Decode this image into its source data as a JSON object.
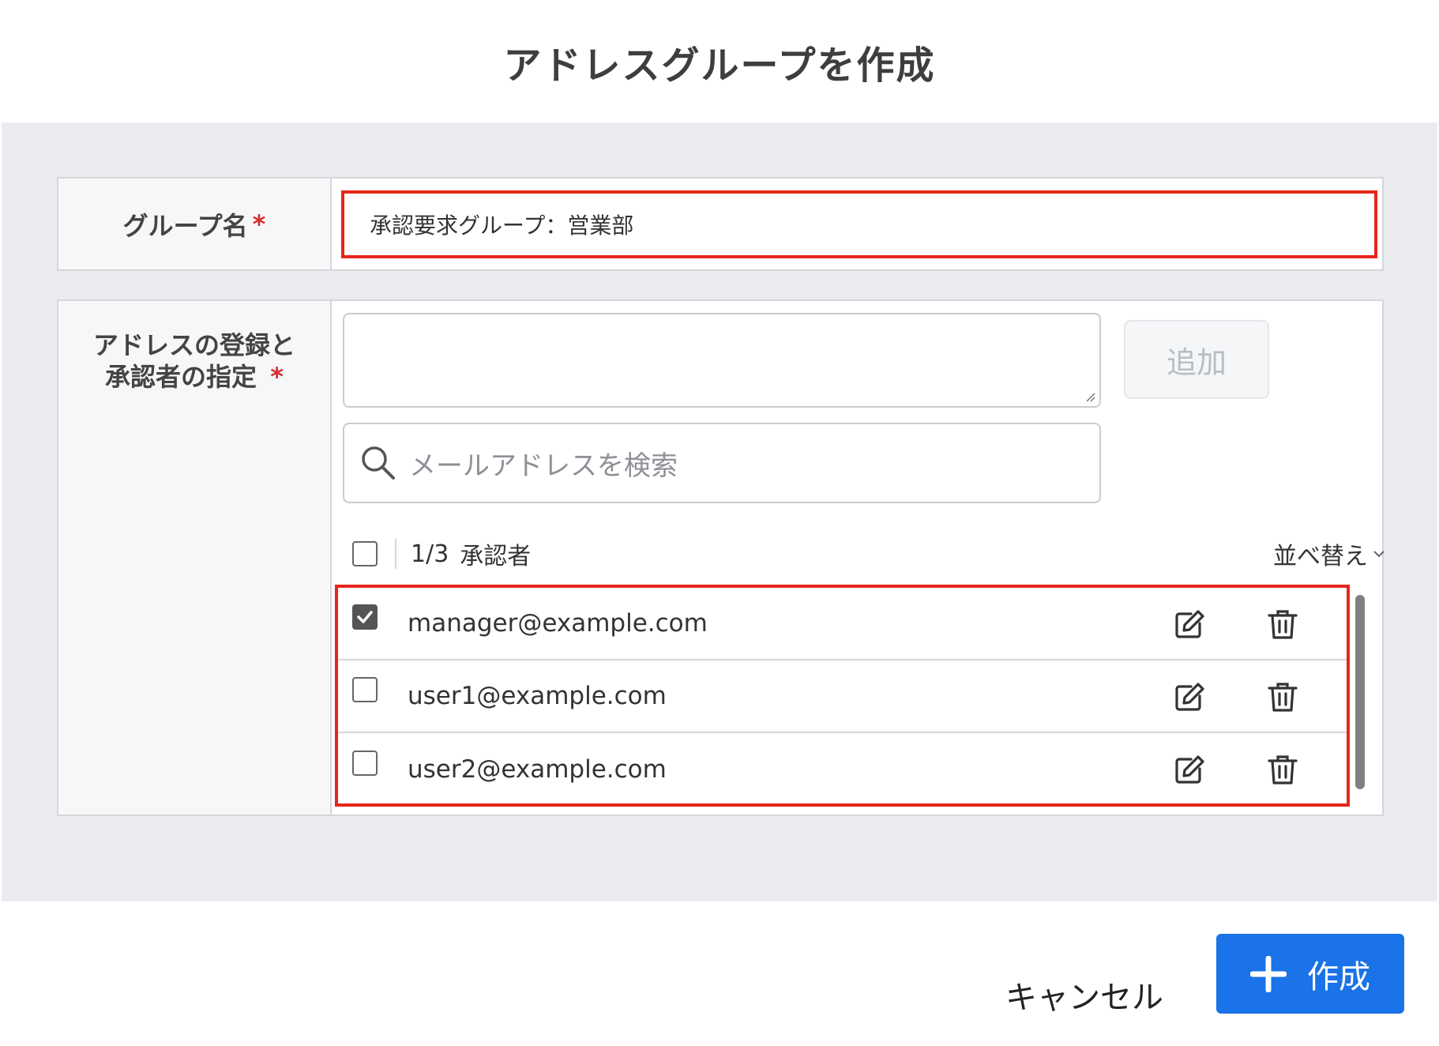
{
  "dialog": {
    "title": "アドレスグループを作成"
  },
  "form": {
    "group_name_label": "グループ名",
    "group_name_value": "承認要求グループ：営業部",
    "address_label_line1": "アドレスの登録と",
    "address_label_line2": "承認者の指定",
    "required_mark": "*",
    "add_button_label": "追加",
    "search_placeholder": "メールアドレスを検索",
    "list_count": "1/3",
    "list_count_suffix": "承認者",
    "sort_label": "並べ替え",
    "addresses": [
      {
        "email": "manager@example.com",
        "checked": true
      },
      {
        "email": "user1@example.com",
        "checked": false
      },
      {
        "email": "user2@example.com",
        "checked": false
      }
    ]
  },
  "footer": {
    "cancel_label": "キャンセル",
    "create_label": "作成"
  },
  "icons": {
    "search": "search-icon",
    "edit": "edit-icon",
    "delete": "trash-icon",
    "sort": "chevron-down-icon",
    "create": "plus-icon"
  },
  "colors": {
    "accent": "#1a73e8",
    "highlight": "#e5261b",
    "required": "#d32f2f"
  }
}
